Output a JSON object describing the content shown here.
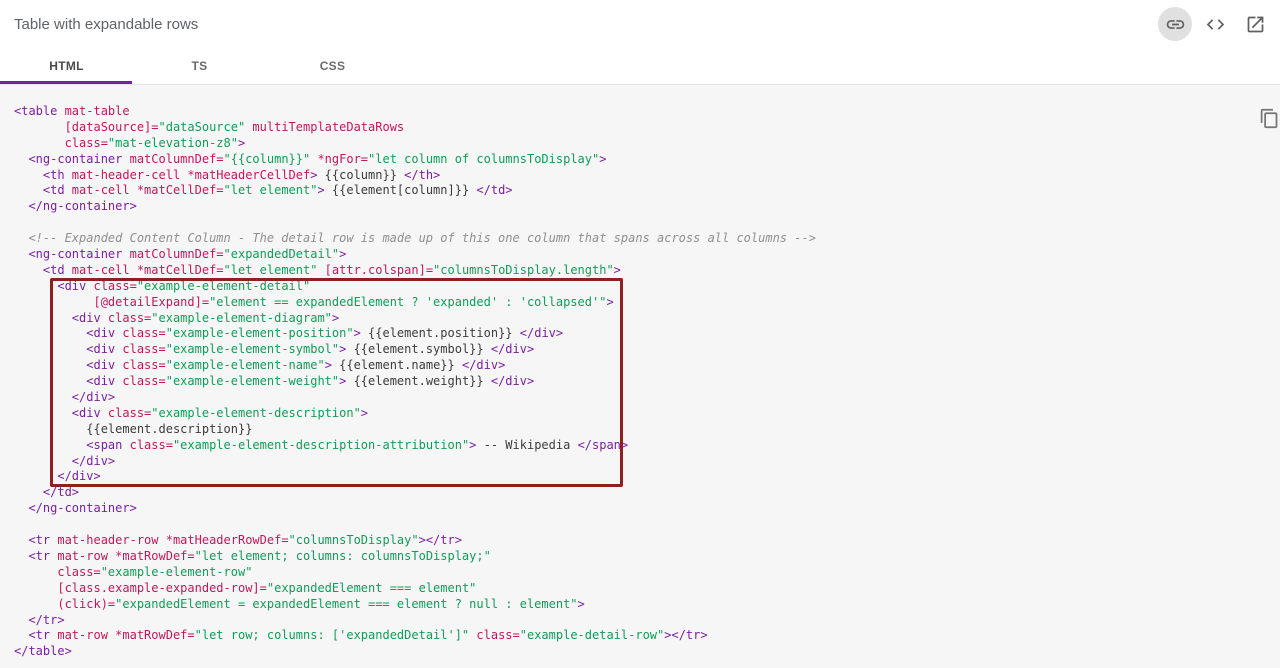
{
  "header": {
    "title": "Table with expandable rows",
    "icons": [
      "link-icon",
      "code-icon",
      "open-in-new-icon"
    ]
  },
  "tabs": [
    {
      "label": "HTML",
      "active": true
    },
    {
      "label": "TS",
      "active": false
    },
    {
      "label": "CSS",
      "active": false
    }
  ],
  "colors": {
    "ink_bar": "#7b1fa2",
    "annotation_border": "#8e2020",
    "code_background": "#f6f6f6",
    "token_tag": "#7b1fa2",
    "token_attribute": "#c2185b",
    "token_string": "#0f9d58",
    "token_comment": "#8f8f8f"
  },
  "code": {
    "copy_icon": "content-copy-icon",
    "lines": [
      [
        [
          "tag",
          "<table"
        ],
        [
          "attr",
          " mat-table"
        ]
      ],
      [
        [
          "attr",
          "       [dataSource]="
        ],
        [
          "str",
          "\"dataSource\""
        ],
        [
          "attr",
          " multiTemplateDataRows"
        ]
      ],
      [
        [
          "attr",
          "       class="
        ],
        [
          "str",
          "\"mat-elevation-z8\""
        ],
        [
          "tag",
          ">"
        ]
      ],
      [
        [
          "tag",
          "  <ng-container"
        ],
        [
          "attr",
          " matColumnDef="
        ],
        [
          "str",
          "\"{{column}}\""
        ],
        [
          "attr",
          " *ngFor="
        ],
        [
          "str",
          "\"let column of columnsToDisplay\""
        ],
        [
          "tag",
          ">"
        ]
      ],
      [
        [
          "tag",
          "    <th"
        ],
        [
          "attr",
          " mat-header-cell *matHeaderCellDef"
        ],
        [
          "tag",
          ">"
        ],
        [
          "txt",
          " {{column}} "
        ],
        [
          "tag",
          "</th>"
        ]
      ],
      [
        [
          "tag",
          "    <td"
        ],
        [
          "attr",
          " mat-cell *matCellDef="
        ],
        [
          "str",
          "\"let element\""
        ],
        [
          "tag",
          ">"
        ],
        [
          "txt",
          " {{element[column]}} "
        ],
        [
          "tag",
          "</td>"
        ]
      ],
      [
        [
          "tag",
          "  </ng-container>"
        ]
      ],
      [],
      [
        [
          "com",
          "  <!-- Expanded Content Column - The detail row is made up of this one column that spans across all columns -->"
        ]
      ],
      [
        [
          "tag",
          "  <ng-container"
        ],
        [
          "attr",
          " matColumnDef="
        ],
        [
          "str",
          "\"expandedDetail\""
        ],
        [
          "tag",
          ">"
        ]
      ],
      [
        [
          "tag",
          "    <td"
        ],
        [
          "attr",
          " mat-cell *matCellDef="
        ],
        [
          "str",
          "\"let element\""
        ],
        [
          "attr",
          " [attr.colspan]="
        ],
        [
          "str",
          "\"columnsToDisplay.length\""
        ],
        [
          "tag",
          ">"
        ]
      ],
      [
        [
          "tag",
          "      <div"
        ],
        [
          "attr",
          " class="
        ],
        [
          "str",
          "\"example-element-detail\""
        ]
      ],
      [
        [
          "attr",
          "           [@detailExpand]="
        ],
        [
          "str",
          "\"element == expandedElement ? 'expanded' : 'collapsed'\""
        ],
        [
          "tag",
          ">"
        ]
      ],
      [
        [
          "tag",
          "        <div"
        ],
        [
          "attr",
          " class="
        ],
        [
          "str",
          "\"example-element-diagram\""
        ],
        [
          "tag",
          ">"
        ]
      ],
      [
        [
          "tag",
          "          <div"
        ],
        [
          "attr",
          " class="
        ],
        [
          "str",
          "\"example-element-position\""
        ],
        [
          "tag",
          ">"
        ],
        [
          "txt",
          " {{element.position}} "
        ],
        [
          "tag",
          "</div>"
        ]
      ],
      [
        [
          "tag",
          "          <div"
        ],
        [
          "attr",
          " class="
        ],
        [
          "str",
          "\"example-element-symbol\""
        ],
        [
          "tag",
          ">"
        ],
        [
          "txt",
          " {{element.symbol}} "
        ],
        [
          "tag",
          "</div>"
        ]
      ],
      [
        [
          "tag",
          "          <div"
        ],
        [
          "attr",
          " class="
        ],
        [
          "str",
          "\"example-element-name\""
        ],
        [
          "tag",
          ">"
        ],
        [
          "txt",
          " {{element.name}} "
        ],
        [
          "tag",
          "</div>"
        ]
      ],
      [
        [
          "tag",
          "          <div"
        ],
        [
          "attr",
          " class="
        ],
        [
          "str",
          "\"example-element-weight\""
        ],
        [
          "tag",
          ">"
        ],
        [
          "txt",
          " {{element.weight}} "
        ],
        [
          "tag",
          "</div>"
        ]
      ],
      [
        [
          "tag",
          "        </div>"
        ]
      ],
      [
        [
          "tag",
          "        <div"
        ],
        [
          "attr",
          " class="
        ],
        [
          "str",
          "\"example-element-description\""
        ],
        [
          "tag",
          ">"
        ]
      ],
      [
        [
          "txt",
          "          {{element.description}}"
        ]
      ],
      [
        [
          "tag",
          "          <span"
        ],
        [
          "attr",
          " class="
        ],
        [
          "str",
          "\"example-element-description-attribution\""
        ],
        [
          "tag",
          ">"
        ],
        [
          "txt",
          " -- Wikipedia "
        ],
        [
          "tag",
          "</span>"
        ]
      ],
      [
        [
          "tag",
          "        </div>"
        ]
      ],
      [
        [
          "tag",
          "      </div>"
        ]
      ],
      [
        [
          "tag",
          "    </td>"
        ]
      ],
      [
        [
          "tag",
          "  </ng-container>"
        ]
      ],
      [],
      [
        [
          "tag",
          "  <tr"
        ],
        [
          "attr",
          " mat-header-row *matHeaderRowDef="
        ],
        [
          "str",
          "\"columnsToDisplay\""
        ],
        [
          "tag",
          "></tr>"
        ]
      ],
      [
        [
          "tag",
          "  <tr"
        ],
        [
          "attr",
          " mat-row *matRowDef="
        ],
        [
          "str",
          "\"let element; columns: columnsToDisplay;\""
        ]
      ],
      [
        [
          "attr",
          "      class="
        ],
        [
          "str",
          "\"example-element-row\""
        ]
      ],
      [
        [
          "attr",
          "      [class.example-expanded-row]="
        ],
        [
          "str",
          "\"expandedElement === element\""
        ]
      ],
      [
        [
          "attr",
          "      (click)="
        ],
        [
          "str",
          "\"expandedElement = expandedElement === element ? null : element\""
        ],
        [
          "tag",
          ">"
        ]
      ],
      [
        [
          "tag",
          "  </tr>"
        ]
      ],
      [
        [
          "tag",
          "  <tr"
        ],
        [
          "attr",
          " mat-row *matRowDef="
        ],
        [
          "str",
          "\"let row; columns: ['expandedDetail']\""
        ],
        [
          "attr",
          " class="
        ],
        [
          "str",
          "\"example-detail-row\""
        ],
        [
          "tag",
          "></tr>"
        ]
      ],
      [
        [
          "tag",
          "</table>"
        ]
      ]
    ]
  }
}
